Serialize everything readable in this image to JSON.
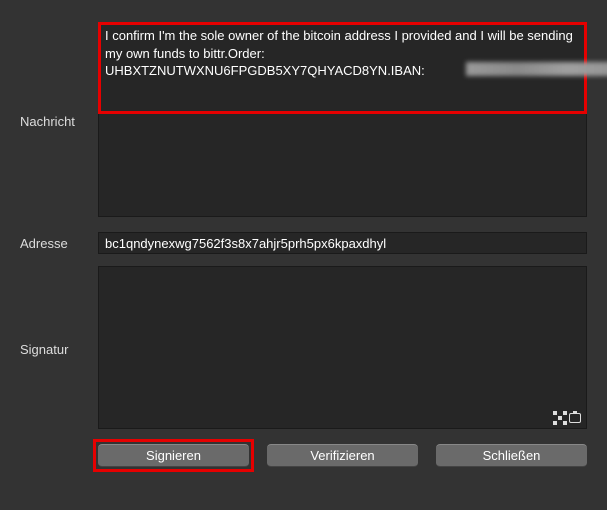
{
  "labels": {
    "message": "Nachricht",
    "address": "Adresse",
    "signature": "Signatur"
  },
  "fields": {
    "message_value": "I confirm I'm the sole owner of the bitcoin address I provided and I will be sending my own funds to bittr.Order: UHBXTZNUTWXNU6FPGDB5XY7QHYACD8YN.IBAN:",
    "address_value": "bc1qndynexwg7562f3s8x7ahjr5prh5px6kpaxdhyl",
    "signature_value": ""
  },
  "buttons": {
    "sign": "Signieren",
    "verify": "Verifizieren",
    "close": "Schließen"
  }
}
